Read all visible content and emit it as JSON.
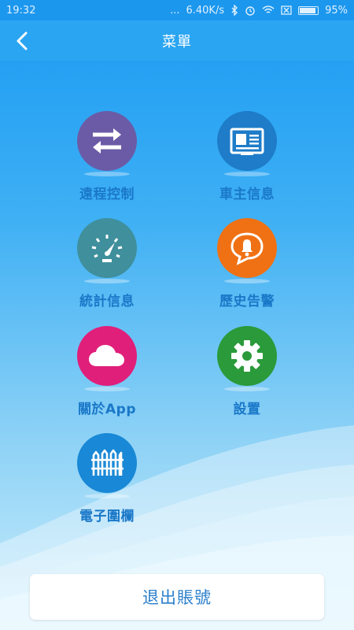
{
  "status_bar": {
    "time": "19:32",
    "dots": "...",
    "speed": "6.40K/s",
    "battery": "95%",
    "battery_level": 0.95,
    "icons": [
      "bluetooth-icon",
      "alarm-icon",
      "wifi-icon",
      "no-sim-icon",
      "battery-icon"
    ]
  },
  "header": {
    "title": "菜單",
    "back_icon": "chevron-left-icon"
  },
  "menu": [
    {
      "id": "remote-control",
      "label": "遠程控制",
      "icon": "swap-arrows-icon",
      "color": "#6b5ba6"
    },
    {
      "id": "owner-info",
      "label": "車主信息",
      "icon": "id-card-icon",
      "color": "#1e7cc8"
    },
    {
      "id": "statistics",
      "label": "統計信息",
      "icon": "speedometer-icon",
      "color": "#3f8f9c"
    },
    {
      "id": "alarm-history",
      "label": "歷史告警",
      "icon": "bell-bubble-icon",
      "color": "#f07114"
    },
    {
      "id": "about",
      "label": "關於App",
      "icon": "cloud-icon",
      "color": "#e01f7a"
    },
    {
      "id": "settings",
      "label": "設置",
      "icon": "gear-icon",
      "color": "#2a9a3a"
    },
    {
      "id": "geofence",
      "label": "電子圍欄",
      "icon": "fence-icon",
      "color": "#1988d6"
    }
  ],
  "logout_label": "退出賬號"
}
